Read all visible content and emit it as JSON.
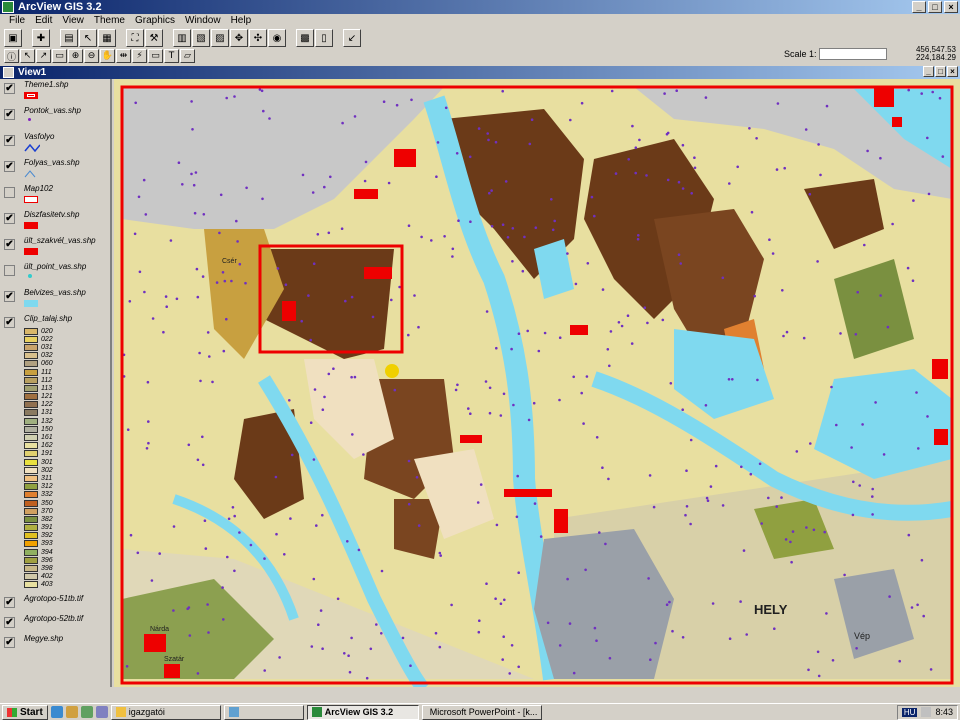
{
  "app": {
    "title": "ArcView GIS 3.2"
  },
  "menu": [
    "File",
    "Edit",
    "View",
    "Theme",
    "Graphics",
    "Window",
    "Help"
  ],
  "window_buttons": {
    "minimize": "_",
    "maximize": "□",
    "close": "×"
  },
  "toolbar1": [
    "save",
    "add-theme",
    "theme-properties",
    "edit-legend",
    "open-table",
    "find",
    "query",
    "locate",
    "chart",
    "layout",
    "zoom-full",
    "zoom-active",
    "zoom-selected",
    "zoom-previous",
    "select-features",
    "clear-selection",
    "help"
  ],
  "toolbar2": [
    "identify",
    "pointer",
    "vertex-edit",
    "select-feature",
    "zoom-in",
    "zoom-out",
    "pan",
    "measure",
    "hotlink",
    "label",
    "text",
    "draw"
  ],
  "scale": {
    "label": "Scale 1:",
    "value": ""
  },
  "coords": {
    "x": "456,547.53",
    "y": "224,184.29"
  },
  "view": {
    "title": "View1"
  },
  "toc": [
    {
      "name": "Theme1.shp",
      "checked": true,
      "symbol": "rect-red-outline"
    },
    {
      "name": "Pontok_vas.shp",
      "checked": true,
      "symbol": "point-purple"
    },
    {
      "name": "Vasfolyo",
      "checked": true,
      "symbol": "line-blue"
    },
    {
      "name": "Folyas_vas.shp",
      "checked": true,
      "symbol": "line-blue-thin"
    },
    {
      "name": "Map102",
      "checked": false,
      "symbol": "rect-red-hollow"
    },
    {
      "name": "Diszfasitetv.shp",
      "checked": true,
      "symbol": "rect-red"
    },
    {
      "name": "ült_szakvél_vas.shp",
      "checked": true,
      "symbol": "rect-red"
    },
    {
      "name": "ült_point_vas.shp",
      "checked": false,
      "symbol": "point-cyan"
    },
    {
      "name": "Belvizes_vas.shp",
      "checked": true,
      "symbol": "rect-cyan"
    },
    {
      "name": "Clip_talaj.shp",
      "checked": true,
      "symbol": "none"
    }
  ],
  "legend": [
    {
      "code": "020",
      "color": "#d9b76a"
    },
    {
      "code": "022",
      "color": "#e8d060"
    },
    {
      "code": "031",
      "color": "#c9a46b"
    },
    {
      "code": "032",
      "color": "#d8c08c"
    },
    {
      "code": "060",
      "color": "#b0a080"
    },
    {
      "code": "111",
      "color": "#c8a040"
    },
    {
      "code": "112",
      "color": "#b8a060"
    },
    {
      "code": "113",
      "color": "#a0a070"
    },
    {
      "code": "121",
      "color": "#a07040"
    },
    {
      "code": "122",
      "color": "#907050"
    },
    {
      "code": "131",
      "color": "#8a7a60"
    },
    {
      "code": "132",
      "color": "#a0b080"
    },
    {
      "code": "150",
      "color": "#b0b0a0"
    },
    {
      "code": "161",
      "color": "#d0d0b0"
    },
    {
      "code": "162",
      "color": "#e8e0a0"
    },
    {
      "code": "191",
      "color": "#e0d070"
    },
    {
      "code": "301",
      "color": "#e8e040"
    },
    {
      "code": "302",
      "color": "#f0e0c0"
    },
    {
      "code": "311",
      "color": "#f0c080"
    },
    {
      "code": "312",
      "color": "#90a040"
    },
    {
      "code": "332",
      "color": "#e08030"
    },
    {
      "code": "350",
      "color": "#c06020"
    },
    {
      "code": "370",
      "color": "#d0a060"
    },
    {
      "code": "382",
      "color": "#7a9040"
    },
    {
      "code": "391",
      "color": "#b0b040"
    },
    {
      "code": "392",
      "color": "#e0c020"
    },
    {
      "code": "393",
      "color": "#f0a000"
    },
    {
      "code": "394",
      "color": "#90b060"
    },
    {
      "code": "396",
      "color": "#a0a040"
    },
    {
      "code": "398",
      "color": "#c8b888"
    },
    {
      "code": "402",
      "color": "#d0c8a8"
    },
    {
      "code": "403",
      "color": "#e8e0a0"
    }
  ],
  "toc_after": [
    {
      "name": "Agrotopo-51tb.tif",
      "checked": true
    },
    {
      "name": "Agrotopo-52tb.tif",
      "checked": true
    },
    {
      "name": "Megye.shp",
      "checked": true
    }
  ],
  "map_labels": {
    "city": "HELY",
    "town1": "Vép",
    "town2": "Nárda",
    "place1": "Szatár",
    "place2": "Csér"
  },
  "taskbar": {
    "start": "Start",
    "tasks": [
      {
        "label": "igazgatói",
        "active": false
      },
      {
        "label": "ArcView GIS 3.2",
        "active": true
      },
      {
        "label": "Microsoft PowerPoint - [k...",
        "active": false
      }
    ],
    "lang": "HU",
    "time": "8:43"
  }
}
